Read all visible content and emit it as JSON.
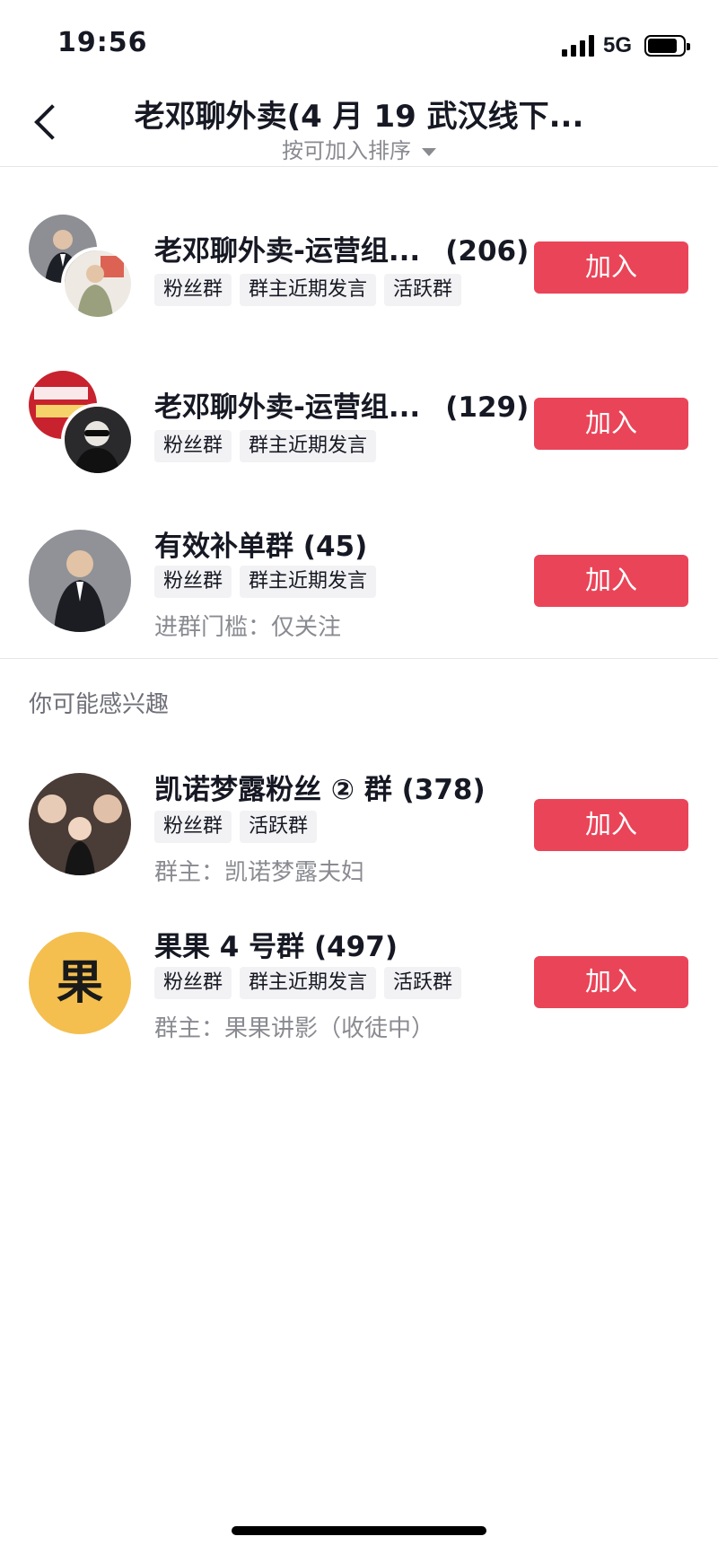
{
  "status_bar": {
    "time": "19:56",
    "network": "5G",
    "battery_level": 0.85,
    "signal_bars": 4
  },
  "nav": {
    "title": "老邓聊外卖(4 月 19 武汉线下...",
    "sort_label": "按可加入排序"
  },
  "groups": [
    {
      "name": "老邓聊外卖-运营组...",
      "count": "(206)",
      "tags": [
        "粉丝群",
        "群主近期发言",
        "活跃群"
      ],
      "join_label": "加入"
    },
    {
      "name": "老邓聊外卖-运营组...",
      "count": "(129)",
      "tags": [
        "粉丝群",
        "群主近期发言"
      ],
      "join_label": "加入"
    },
    {
      "name": "有效补单群 (45)",
      "tags": [
        "粉丝群",
        "群主近期发言"
      ],
      "meta": "进群门槛：仅关注",
      "join_label": "加入"
    }
  ],
  "recommend": {
    "section_title": "你可能感兴趣",
    "items": [
      {
        "name": "凯诺梦露粉丝 ② 群 (378)",
        "tags": [
          "粉丝群",
          "活跃群"
        ],
        "meta": "群主：凯诺梦露夫妇",
        "join_label": "加入"
      },
      {
        "name": "果果 4 号群 (497)",
        "tags": [
          "粉丝群",
          "群主近期发言",
          "活跃群"
        ],
        "meta": "群主：果果讲影（收徒中）",
        "join_label": "加入",
        "avatar_text": "果"
      }
    ]
  },
  "colors": {
    "accent": "#ea4458",
    "tag_bg": "#f2f2f4",
    "muted_text": "#8a8b91"
  }
}
